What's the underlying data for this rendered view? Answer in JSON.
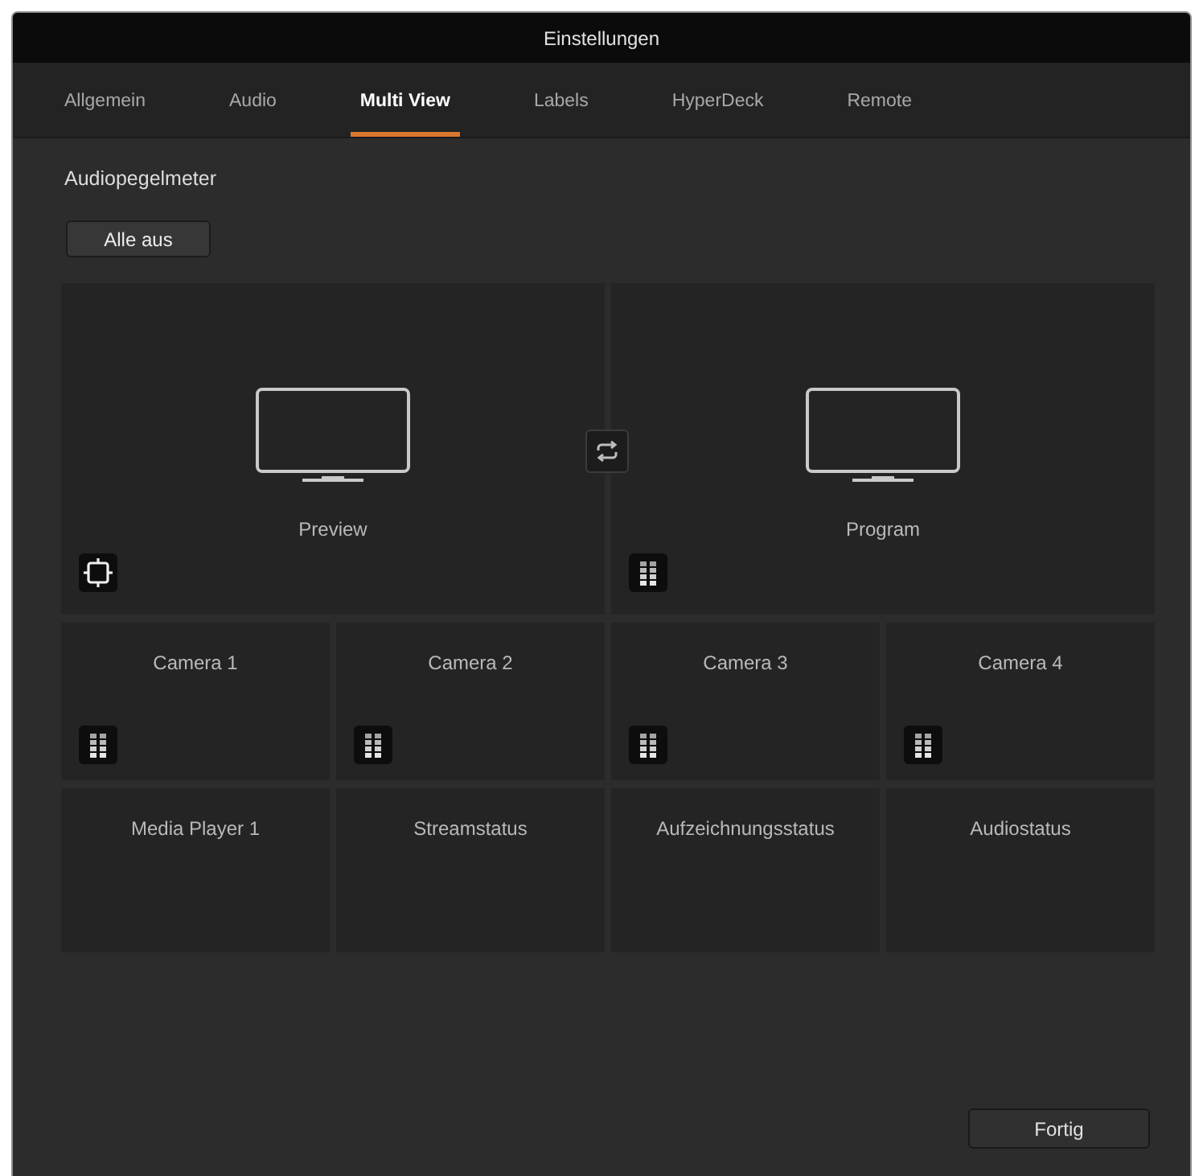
{
  "window": {
    "title": "Einstellungen"
  },
  "tabs": [
    {
      "label": "Allgemein",
      "selected": false
    },
    {
      "label": "Audio",
      "selected": false
    },
    {
      "label": "Multi View",
      "selected": true
    },
    {
      "label": "Labels",
      "selected": false
    },
    {
      "label": "HyperDeck",
      "selected": false
    },
    {
      "label": "Remote",
      "selected": false
    }
  ],
  "section": {
    "label": "Audiopegelmeter",
    "button": "Alle aus"
  },
  "multiview": {
    "main_windows": [
      {
        "label": "Preview",
        "kind": "guides"
      },
      {
        "label": "Program",
        "kind": "meter"
      }
    ],
    "small_windows": [
      {
        "label": "Camera 1",
        "kind": "meter"
      },
      {
        "label": "Camera 2",
        "kind": "meter"
      },
      {
        "label": "Camera 3",
        "kind": "meter"
      },
      {
        "label": "Camera 4",
        "kind": "meter"
      },
      {
        "label": "Media Player 1",
        "kind": "plain"
      },
      {
        "label": "Streamstatus",
        "kind": "plain"
      },
      {
        "label": "Aufzeichnungsstatus",
        "kind": "plain"
      },
      {
        "label": "Audiostatus",
        "kind": "plain"
      }
    ]
  },
  "footer": {
    "done_button": "Fortig"
  }
}
